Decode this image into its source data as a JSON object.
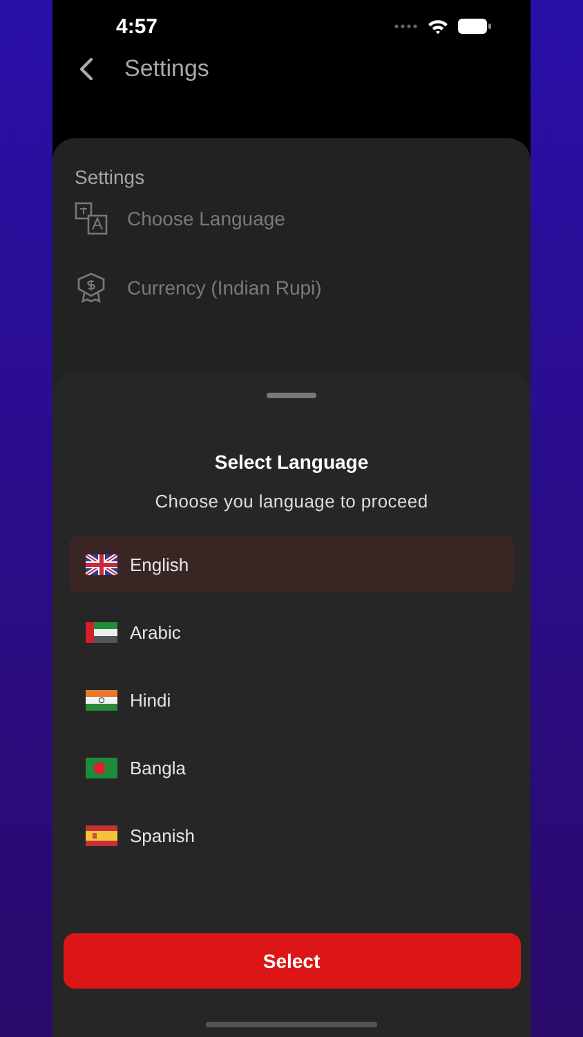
{
  "status_bar": {
    "time": "4:57"
  },
  "nav_bar": {
    "title": "Settings"
  },
  "settings": {
    "heading": "Settings",
    "items": [
      {
        "label": "Choose Language",
        "kind": "language"
      },
      {
        "label": "Currency (Indian Rupi)",
        "kind": "currency"
      }
    ]
  },
  "sheet": {
    "title": "Select Language",
    "subtitle": "Choose you language to proceed",
    "languages": [
      {
        "label": "English",
        "kind": "uk",
        "selected": true
      },
      {
        "label": "Arabic",
        "kind": "uae",
        "selected": false
      },
      {
        "label": "Hindi",
        "kind": "india",
        "selected": false
      },
      {
        "label": "Bangla",
        "kind": "bangladesh",
        "selected": false
      },
      {
        "label": "Spanish",
        "kind": "spain",
        "selected": false
      }
    ],
    "button": "Select"
  }
}
